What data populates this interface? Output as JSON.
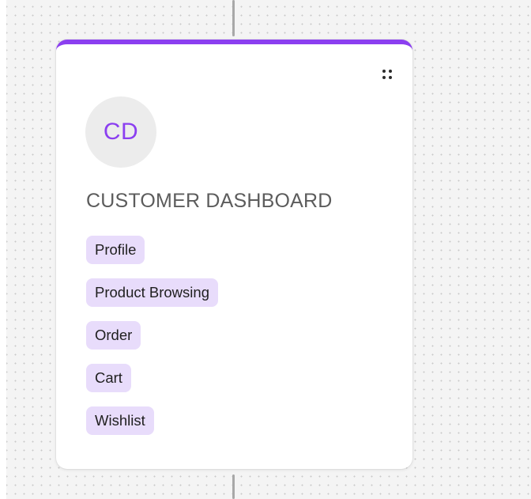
{
  "node": {
    "avatar_initials": "CD",
    "title": "CUSTOMER DASHBOARD",
    "tags": [
      "Profile",
      "Product Browsing",
      "Order",
      "Cart",
      "Wishlist"
    ],
    "handle_icon": "drag-handle-icon"
  },
  "colors": {
    "accent": "#8b3ff0",
    "tag_background": "#e8dcfb",
    "avatar_background": "#ececec",
    "canvas_background": "#f4f4f4",
    "canvas_dots": "#c9c9c9",
    "connector": "#a8a8a8"
  }
}
